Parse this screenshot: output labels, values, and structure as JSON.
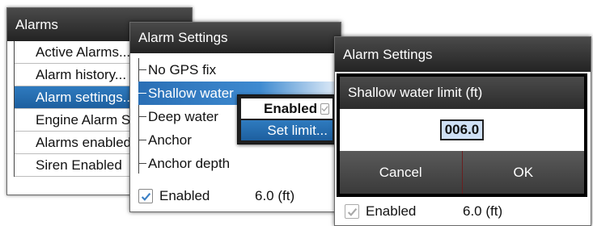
{
  "alarms_window": {
    "title": "Alarms",
    "items": [
      {
        "label": "Active Alarms..."
      },
      {
        "label": "Alarm history..."
      },
      {
        "label": "Alarm settings..."
      },
      {
        "label": "Engine Alarm Se"
      },
      {
        "label": "Alarms enabled"
      },
      {
        "label": "Siren Enabled"
      }
    ],
    "selected_index": 2
  },
  "alarm_settings_window": {
    "title": "Alarm Settings",
    "items": [
      {
        "label": "No GPS fix"
      },
      {
        "label": "Shallow water"
      },
      {
        "label": "Deep water"
      },
      {
        "label": "Anchor"
      },
      {
        "label": "Anchor depth"
      }
    ],
    "selected_index": 1,
    "footer": {
      "enabled_label": "Enabled",
      "value": "6.0 (ft)",
      "checked": true
    }
  },
  "context_popup": {
    "enabled_label": "Enabled",
    "set_limit_label": "Set limit..."
  },
  "limit_window": {
    "title": "Alarm Settings",
    "dialog": {
      "title": "Shallow water limit (ft)",
      "value": "006.0",
      "cancel_label": "Cancel",
      "ok_label": "OK"
    },
    "footer": {
      "enabled_label": "Enabled",
      "value": "6.0 (ft)",
      "checked": true
    }
  },
  "colors": {
    "selection": "#2f7bbf",
    "titlebar": "#2e2e2e",
    "check_blue": "#3a7fc4",
    "check_gray": "#a8a8a8"
  }
}
